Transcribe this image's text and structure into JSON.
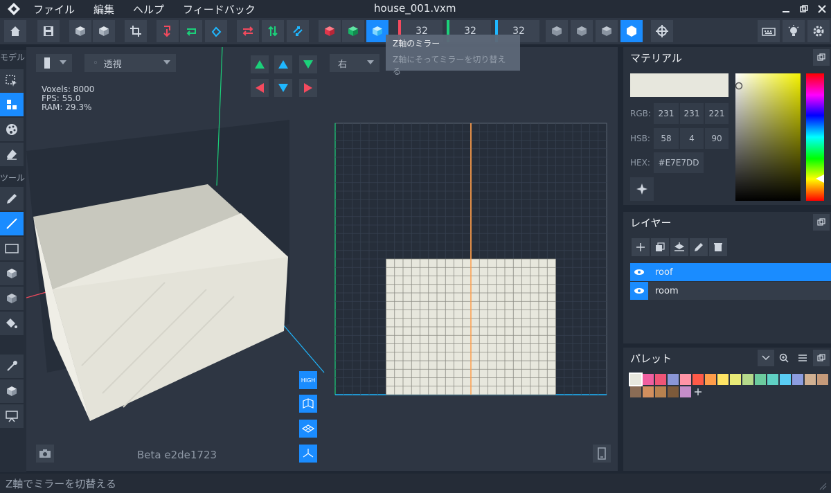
{
  "menu": {
    "items": [
      "ファイル",
      "編集",
      "ヘルプ",
      "フィードバック"
    ]
  },
  "window": {
    "title": "house_001.vxm"
  },
  "toolbar": {
    "axis_x": "32",
    "axis_y": "32",
    "axis_z": "32",
    "colors": {
      "x": "#f44a5e",
      "y": "#1bd17a",
      "z": "#1fb7ff",
      "accent": "#1a8cff"
    }
  },
  "tooltip": {
    "title": "Z軸のミラー",
    "desc": "Z軸にそってミラーを切り替える"
  },
  "sidebar": {
    "section_model": "モデル",
    "section_tools": "ツール"
  },
  "viewport": {
    "view_mode": "透視",
    "side_select": "右",
    "stats": {
      "voxels": "Voxels: 8000",
      "fps": "FPS: 55.0",
      "ram": "RAM: 29.3%"
    },
    "beta": "Beta e2de1723",
    "high_label": "HIGH"
  },
  "material": {
    "title": "マテリアル",
    "swatch_color": "#e7e7dd",
    "rgb_label": "RGB:",
    "rgb": [
      "231",
      "231",
      "221"
    ],
    "hsb_label": "HSB:",
    "hsb": [
      "58",
      "4",
      "90"
    ],
    "hex_label": "HEX:",
    "hex": "#E7E7DD"
  },
  "layers": {
    "title": "レイヤー",
    "items": [
      {
        "name": "roof",
        "selected": true
      },
      {
        "name": "room",
        "selected": false
      }
    ]
  },
  "palette": {
    "title": "パレット",
    "colors": [
      "#e7e7dd",
      "#f05fa0",
      "#ef5577",
      "#8a96d6",
      "#ff94a6",
      "#ff5a48",
      "#ff9d4a",
      "#ffe464",
      "#e8ea77",
      "#b5d98a",
      "#6ccb9e",
      "#5fd1c4",
      "#5acdf5",
      "#8c9de0",
      "#d0b092",
      "#c59a7a",
      "#8a6c55",
      "#d28f5e",
      "#b8824f",
      "#7d5a3a",
      "#c48dc8"
    ]
  },
  "status": {
    "text": "Z軸でミラーを切替える"
  }
}
